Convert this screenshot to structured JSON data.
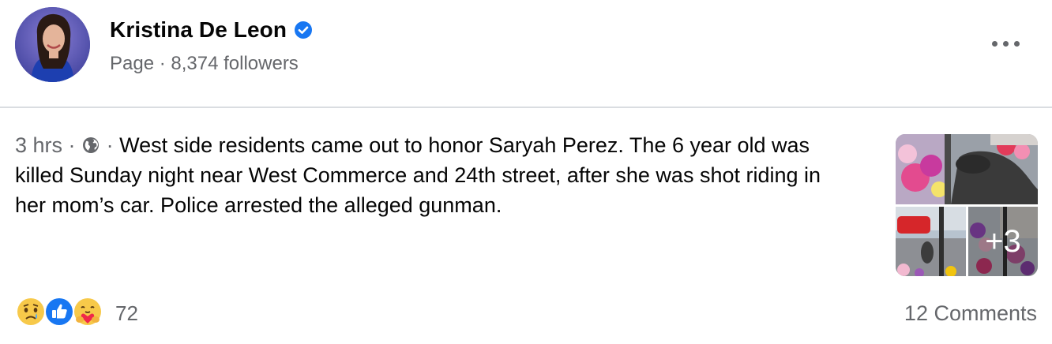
{
  "page": {
    "name": "Kristina De Leon",
    "subline": "Page · 8,374 followers"
  },
  "post": {
    "time": "3 hrs",
    "separator": "·",
    "text": "West side residents came out to honor Saryah Perez. The 6 year old was killed Sunday night near West Commerce and 24th street, after she was shot riding in her mom’s car. Police arrested the alleged gunman.",
    "extra_photos": "+3"
  },
  "footer": {
    "reaction_count": "72",
    "comments": "12 Comments",
    "reaction_icons": [
      "sad-reaction-icon",
      "like-reaction-icon",
      "care-reaction-icon"
    ]
  },
  "colors": {
    "secondary_text": "#65676b",
    "brand_blue": "#1877f2",
    "divider": "#dadde1"
  }
}
